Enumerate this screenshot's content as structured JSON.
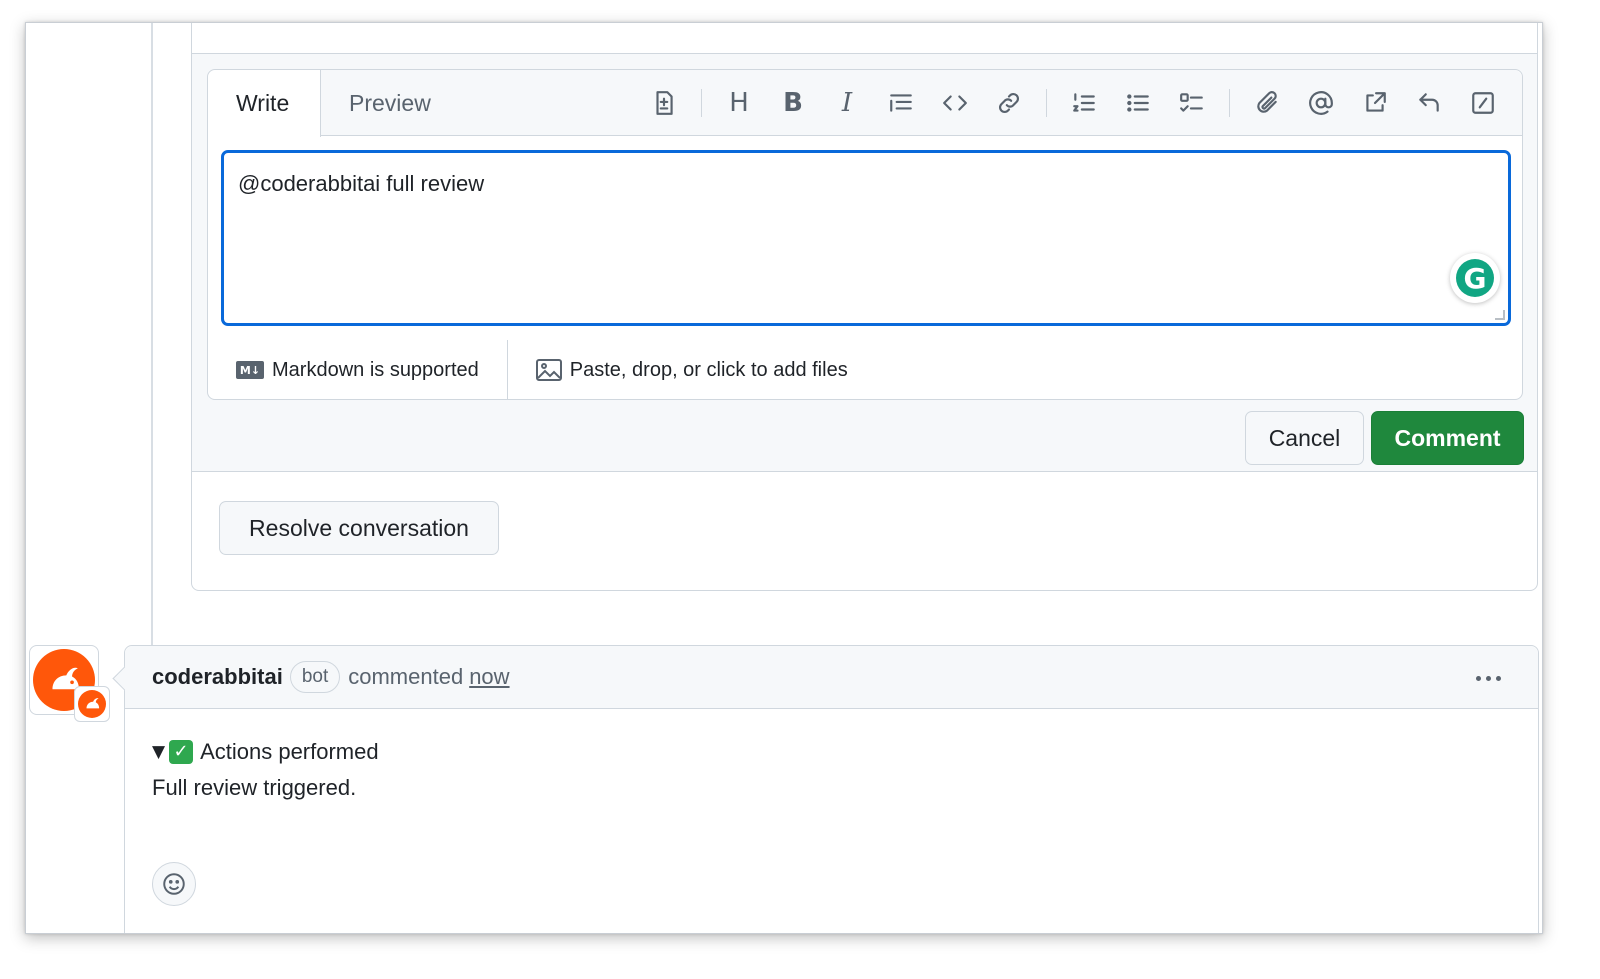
{
  "editor": {
    "tabs": [
      {
        "label": "Write",
        "active": true
      },
      {
        "label": "Preview",
        "active": false
      }
    ],
    "toolbar": {
      "icons": [
        "add-suggestion-icon",
        "heading-icon",
        "bold-icon",
        "italic-icon",
        "quote-icon",
        "code-icon",
        "link-icon",
        "ordered-list-icon",
        "unordered-list-icon",
        "task-list-icon",
        "attach-icon",
        "mention-icon",
        "cross-reference-icon",
        "saved-reply-icon",
        "slash-command-icon"
      ],
      "heading_glyph": "H",
      "bold_glyph": "B",
      "italic_glyph": "I"
    },
    "textarea_value": "@coderabbitai full review",
    "grammarly_letter": "G",
    "markdown_badge": "M↓",
    "markdown_hint": "Markdown is supported",
    "files_hint": "Paste, drop, or click to add files",
    "focus_color": "#0969da"
  },
  "actions": {
    "cancel_label": "Cancel",
    "comment_label": "Comment",
    "resolve_label": "Resolve conversation",
    "primary_color": "#1f883d"
  },
  "comment": {
    "author": "coderabbitai",
    "badge": "bot",
    "action": "commented",
    "time": "now",
    "summary_triangle": "▼",
    "summary_check": "✓",
    "summary": "Actions performed",
    "body": "Full review triggered.",
    "avatar_color": "#ff570a"
  }
}
